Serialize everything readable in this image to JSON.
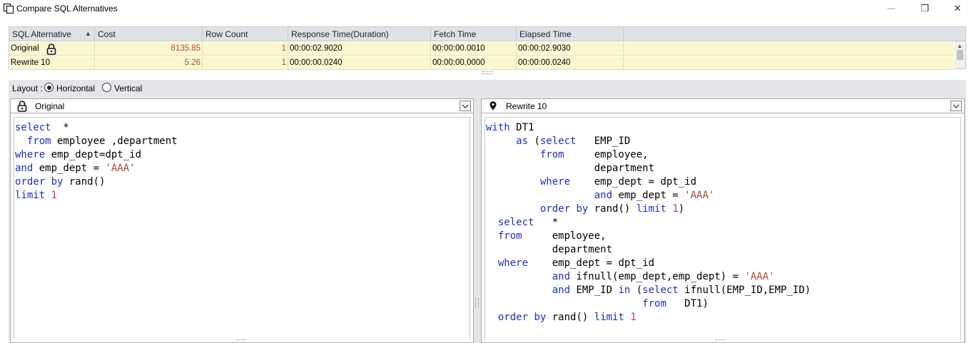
{
  "window": {
    "title": "Compare SQL Alternatives",
    "minimize_glyph": "—",
    "maximize_glyph": "❐",
    "close_glyph": "✕"
  },
  "grid": {
    "columns": [
      "SQL Alternative",
      "Cost",
      "Row Count",
      "Response Time(Duration)",
      "Fetch Time",
      "Elapsed Time"
    ],
    "sorted_column": "SQL Alternative",
    "rows": [
      {
        "name": "Original",
        "cost": "8135.85",
        "row_count": "1",
        "response_time": "00:00:02.9020",
        "fetch_time": "00:00:00.0010",
        "elapsed_time": "00:00:02.9030",
        "locked": true
      },
      {
        "name": "Rewrite 10",
        "cost": "5.26",
        "row_count": "1",
        "response_time": "00:00:00.0240",
        "fetch_time": "00:00:00.0000",
        "elapsed_time": "00:00:00.0240",
        "locked": false
      }
    ]
  },
  "layout": {
    "label": "Layout :",
    "options": [
      "Horizontal",
      "Vertical"
    ],
    "selected": "Horizontal"
  },
  "left_pane": {
    "title": "Original",
    "icon": "lock-icon",
    "sql": "select  *\n  from employee ,department\nwhere emp_dept=dpt_id\nand emp_dept = 'AAA'\norder by rand()\nlimit 1"
  },
  "right_pane": {
    "title": "Rewrite 10",
    "icon": "pin-icon",
    "sql": "with DT1\n     as (select   EMP_ID\n         from     employee,\n                  department\n         where    emp_dept = dpt_id\n                  and emp_dept = 'AAA'\n         order by rand() limit 1)\n  select   *\n  from     employee,\n           department\n  where    emp_dept = dpt_id\n           and ifnull(emp_dept,emp_dept) = 'AAA'\n           and EMP_ID in (select ifnull(EMP_ID,EMP_ID)\n                          from   DT1)\n  order by rand() limit 1"
  },
  "colors": {
    "keyword": "#1c2fc6",
    "literal": "#b04a3a",
    "row_highlight": "#fbf8d0",
    "header_bg": "#dfe3e8"
  }
}
